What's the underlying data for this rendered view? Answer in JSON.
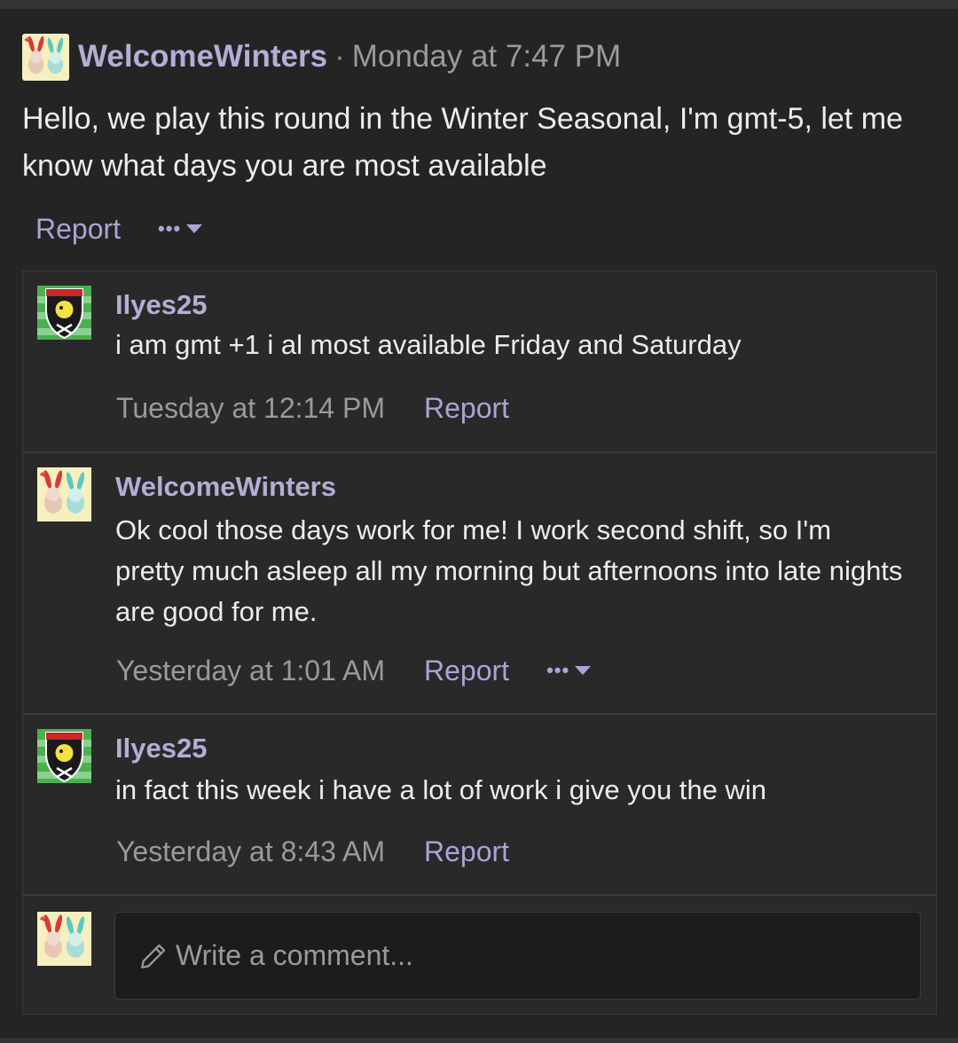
{
  "post": {
    "author": "WelcomeWinters",
    "separator": "·",
    "time": "Monday at 7:47 PM",
    "body": "Hello, we play this round in the Winter Seasonal, I'm gmt-5, let me know what days you are most available",
    "report_label": "Report",
    "more_label": "•••"
  },
  "comments": [
    {
      "author": "Ilyes25",
      "avatar": "shield-crest-avatar",
      "text": "i am gmt +1 i al most available Friday and Saturday",
      "time": "Tuesday at 12:14 PM",
      "report_label": "Report"
    },
    {
      "author": "WelcomeWinters",
      "avatar": "bunny-pair-avatar",
      "text": "Ok cool those days work for me! I work second shift, so I'm pretty much asleep all my morning but afternoons into late nights are good for me.",
      "time": "Yesterday at 1:01 AM",
      "report_label": "Report",
      "more_label": "•••"
    },
    {
      "author": "Ilyes25",
      "avatar": "shield-crest-avatar",
      "text": "in fact this week i have a lot of work i give you the win",
      "time": "Yesterday at 8:43 AM",
      "report_label": "Report"
    }
  ],
  "composer": {
    "placeholder": "Write a comment..."
  },
  "colors": {
    "background": "#242424",
    "username": "#b3aed6",
    "link": "#aaa4d6",
    "muted": "#9a9a9a"
  }
}
